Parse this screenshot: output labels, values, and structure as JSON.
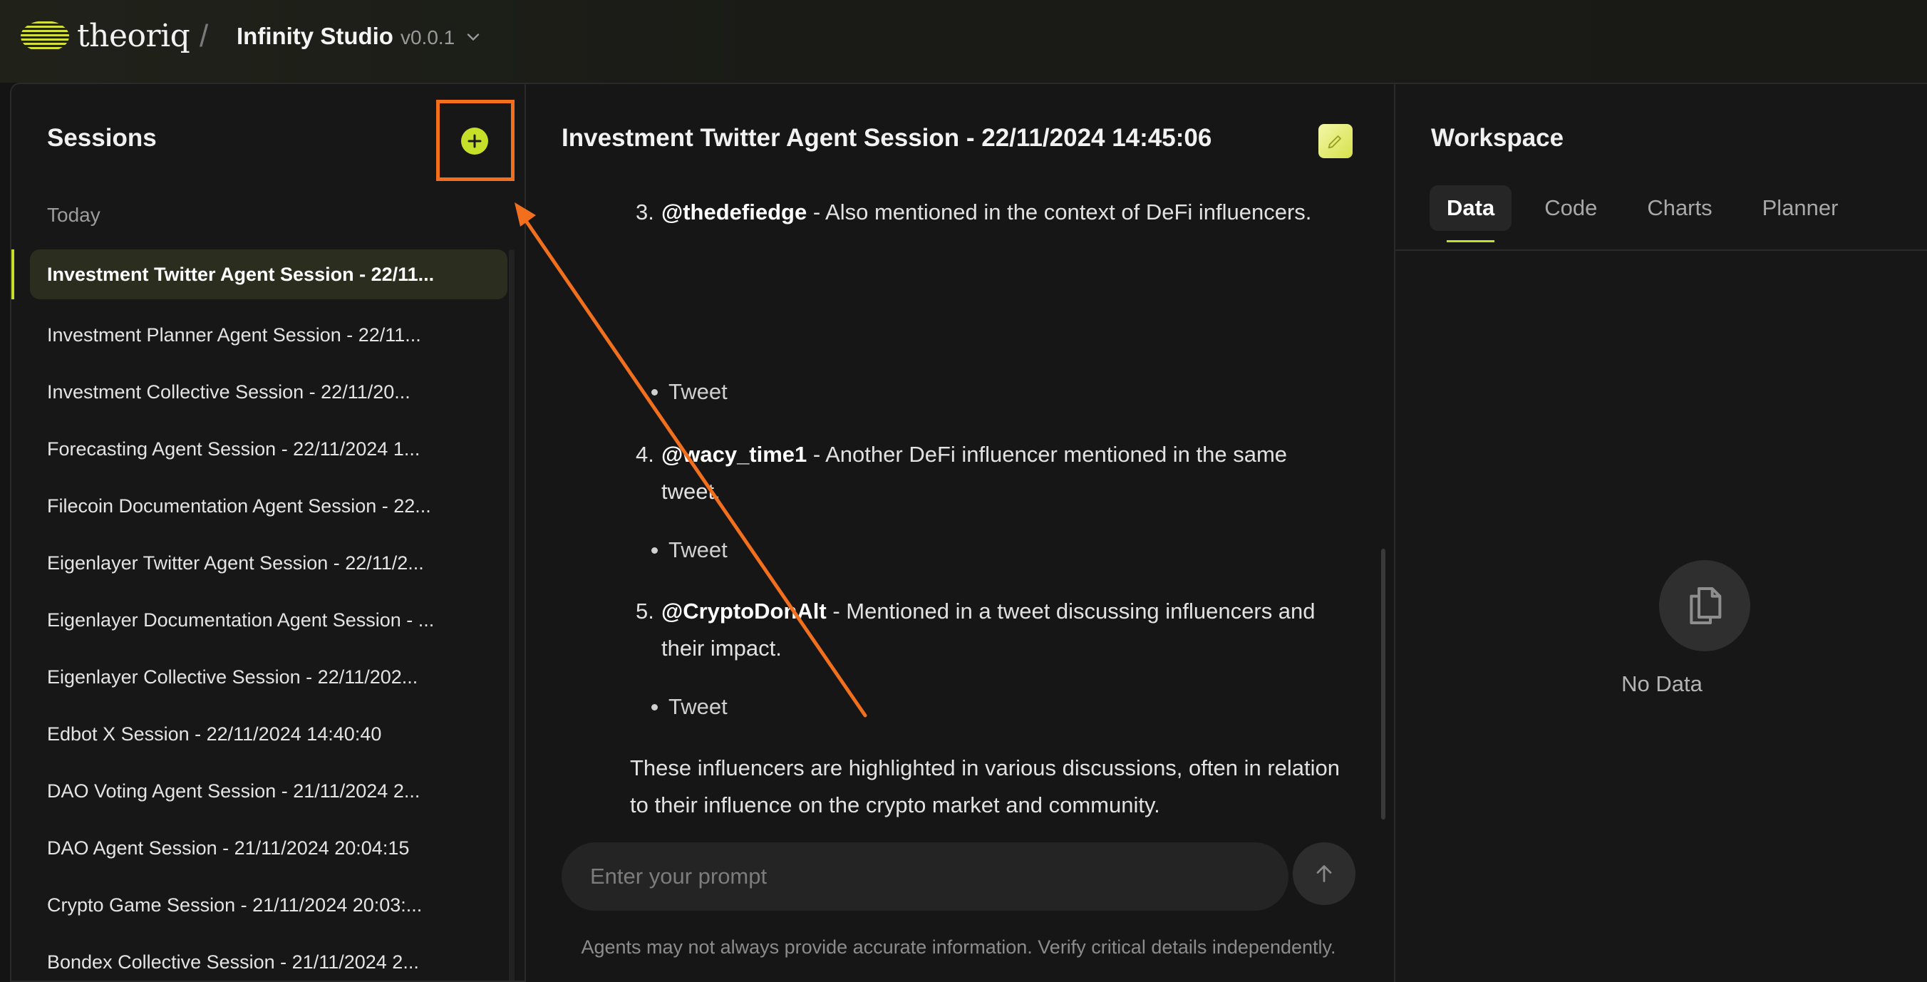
{
  "header": {
    "brand": "theoriq",
    "separator": "/",
    "studio_name": "Infinity Studio",
    "studio_version": "v0.0.1"
  },
  "sessions": {
    "title": "Sessions",
    "group_label": "Today",
    "items": [
      {
        "label": "Investment Twitter Agent Session - 22/11..."
      },
      {
        "label": "Investment Planner Agent Session - 22/11..."
      },
      {
        "label": "Investment Collective Session - 22/11/20..."
      },
      {
        "label": "Forecasting Agent Session - 22/11/2024 1..."
      },
      {
        "label": "Filecoin Documentation Agent Session - 22..."
      },
      {
        "label": "Eigenlayer Twitter Agent Session - 22/11/2..."
      },
      {
        "label": "Eigenlayer Documentation Agent Session - ..."
      },
      {
        "label": "Eigenlayer Collective Session - 22/11/202..."
      },
      {
        "label": "Edbot X Session - 22/11/2024 14:40:40"
      },
      {
        "label": "DAO Voting Agent Session - 21/11/2024 2..."
      },
      {
        "label": "DAO Agent Session - 21/11/2024 20:04:15"
      },
      {
        "label": "Crypto Game Session - 21/11/2024 20:03:..."
      },
      {
        "label": "Bondex Collective Session - 21/11/2024 2..."
      }
    ]
  },
  "chat": {
    "title": "Investment Twitter Agent Session - 22/11/2024 14:45:06",
    "list": [
      {
        "num": "3.",
        "handle": "@thedefiedge",
        "text": " - Also mentioned in the context of DeFi influencers."
      },
      {
        "bullet": "Tweet"
      },
      {
        "num": "4.",
        "handle": "@wacy_time1",
        "text": " - Another DeFi influencer mentioned in the same tweet."
      },
      {
        "bullet": "Tweet"
      },
      {
        "num": "5.",
        "handle": "@CryptoDonAlt",
        "text": " - Mentioned in a tweet discussing influencers and their impact."
      },
      {
        "bullet": "Tweet"
      }
    ],
    "summary": "These influencers are highlighted in various discussions, often in relation to their influence on the crypto market and community.",
    "prompt_placeholder": "Enter your prompt",
    "disclaimer": "Agents may not always provide accurate information. Verify critical details independently."
  },
  "workspace": {
    "title": "Workspace",
    "tabs": [
      {
        "label": "Data",
        "active": true
      },
      {
        "label": "Code"
      },
      {
        "label": "Charts"
      },
      {
        "label": "Planner"
      }
    ],
    "empty_label": "No Data"
  },
  "colors": {
    "accent": "#c6e02a",
    "annotation": "#f2701d"
  },
  "icons": [
    "theoriq-logo-icon",
    "chevron-down-icon",
    "plus-icon",
    "edit-icon",
    "arrow-up-icon",
    "copy-icon"
  ]
}
